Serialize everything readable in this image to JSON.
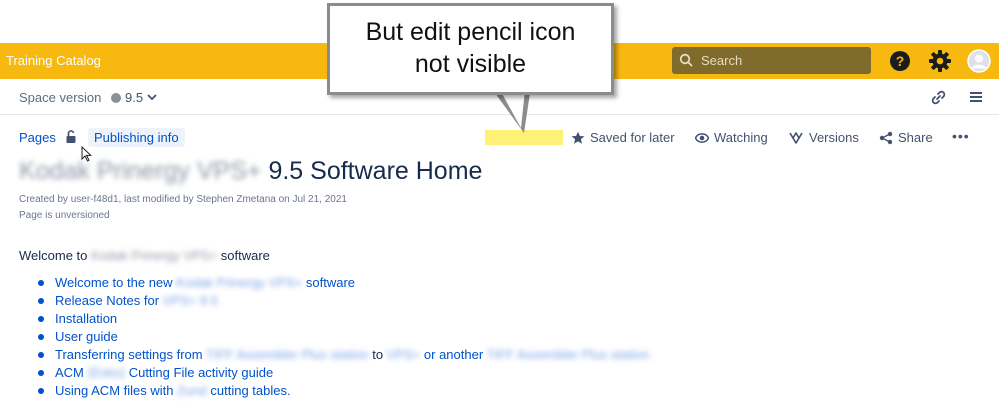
{
  "header": {
    "brand": "Training Catalog",
    "search_placeholder": "Search",
    "icons": [
      "help-icon",
      "gear-icon",
      "avatar-icon"
    ]
  },
  "space": {
    "label": "Space version",
    "version": "9.5"
  },
  "page_meta": {
    "pages_link": "Pages",
    "publishing_info": "Publishing info",
    "saved": "Saved for later",
    "watching": "Watching",
    "versions": "Versions",
    "share": "Share",
    "more": "•••"
  },
  "title": {
    "redacted": "Kodak Prinergy VPS+",
    "text": "9.5 Software Home"
  },
  "byline": {
    "text": "Created by user-f48d1, last modified by Stephen Zmetana on Jul 21, 2021",
    "unversioned": "Page is unversioned"
  },
  "content": {
    "welcome_prefix": "Welcome to",
    "welcome_redacted": "Kodak Prinergy VPS+",
    "welcome_suffix": "software",
    "items": [
      {
        "a": "Welcome to the new",
        "r": "Kodak Prinergy VPS+",
        "b": "software"
      },
      {
        "a": "Release Notes for",
        "r": "VPS+ 9.5"
      },
      {
        "a": "Installation"
      },
      {
        "a": "User guide"
      },
      {
        "a": "Transferring settings from",
        "r": "TIFF Assembler Plus station",
        "mid": "to",
        "r2": "VPS+",
        "c": "or another",
        "r3": "TIFF Assembler Plus station"
      },
      {
        "a": "ACM",
        "r": "(Esko)",
        "b": "Cutting File activity guide"
      },
      {
        "a": "Using ACM files with",
        "r": "Zund",
        "b": "cutting tables."
      }
    ]
  },
  "annotation": {
    "line1": "But edit pencil icon",
    "line2": "not visible"
  },
  "colors": {
    "topbar": "#f7b90f",
    "search": "#7f6b2b",
    "link": "#0052cc",
    "highlight": "#fff176"
  }
}
